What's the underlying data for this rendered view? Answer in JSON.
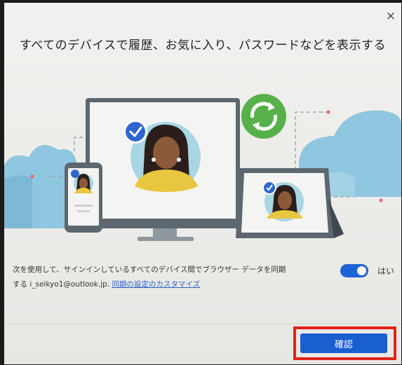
{
  "dialog": {
    "close_glyph": "×",
    "title": "すべてのデバイスで履歴、お気に入り、パスワードなどを表示する",
    "sync_text_1": "次を使用して、サインインしているすべてのデバイス間でブラウザー データを同期",
    "sync_text_2_prefix": "する i_seikyo1@outlook.jp.",
    "customize_link": "同期の設定のカスタマイズ",
    "toggle_label": "はい",
    "toggle_on": true,
    "confirm_label": "確認"
  },
  "colors": {
    "accent": "#1a5fd0",
    "sync_green": "#57b14a",
    "highlight_red": "#e2231a",
    "cloud_blue": "#8fc6e0"
  },
  "icons": [
    "close-icon",
    "sync-icon",
    "checkmark-icon",
    "avatar"
  ]
}
